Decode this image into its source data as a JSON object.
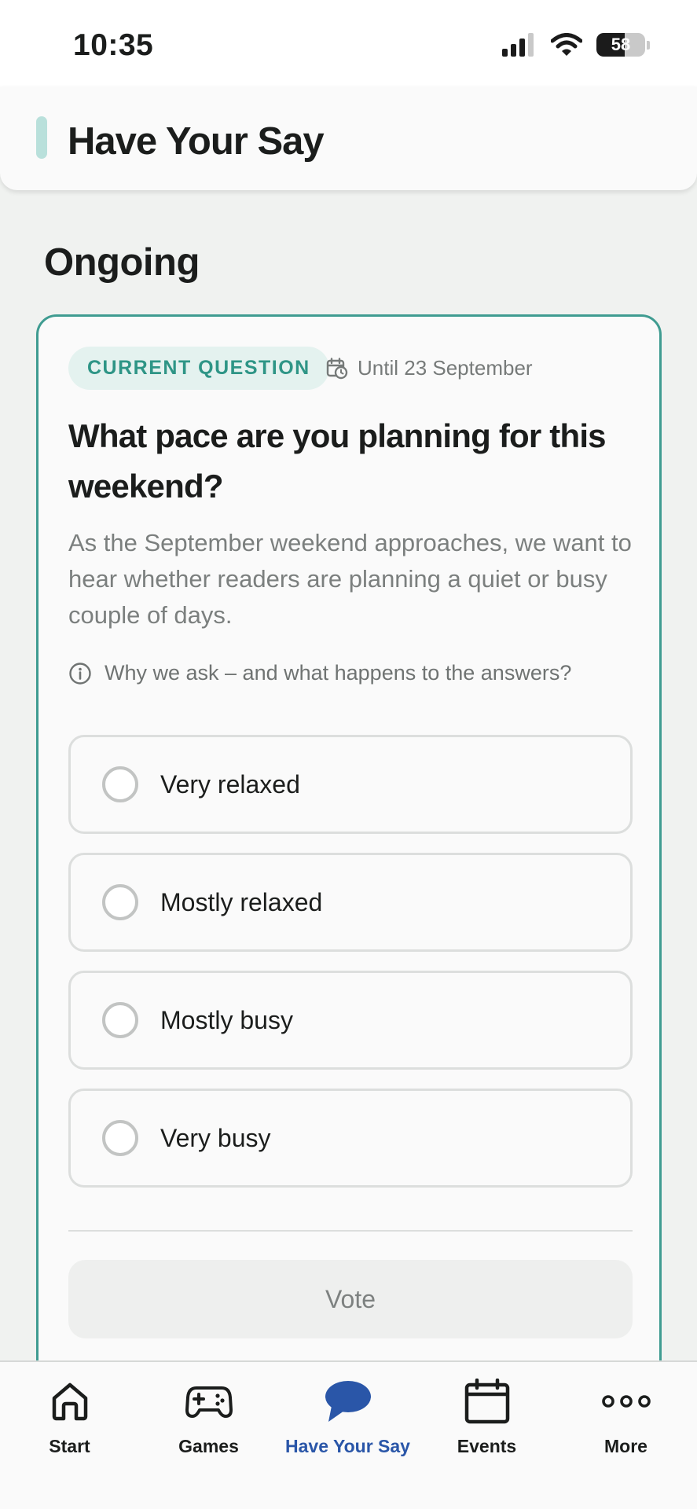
{
  "status_bar": {
    "time": "10:35",
    "battery": "58",
    "battery_level": 0.58
  },
  "header": {
    "title": "Have Your Say"
  },
  "section": {
    "title": "Ongoing"
  },
  "card": {
    "chip": "CURRENT QUESTION",
    "deadline": "Until 23 September",
    "question": "What pace are you planning for this weekend?",
    "intro": "As the September weekend approaches, we want to hear whether readers are planning a quiet or busy couple of days.",
    "why_link": "Why we ask – and what happens to the answers?",
    "options": [
      {
        "label": "Very relaxed"
      },
      {
        "label": "Mostly relaxed"
      },
      {
        "label": "Mostly busy"
      },
      {
        "label": "Very busy"
      }
    ],
    "vote_label": "Vote"
  },
  "tabbar": {
    "active": "Have Your Say",
    "active_color": "#2a56a8",
    "items": [
      {
        "label": "Start",
        "icon": "home-icon"
      },
      {
        "label": "Games",
        "icon": "gamepad-icon"
      },
      {
        "label": "Have Your Say",
        "icon": "speech-bubble-icon"
      },
      {
        "label": "Events",
        "icon": "calendar-icon"
      },
      {
        "label": "More",
        "icon": "more-dots-icon"
      }
    ]
  }
}
